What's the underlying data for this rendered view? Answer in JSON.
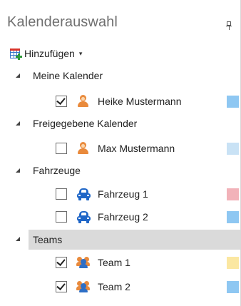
{
  "panel": {
    "title": "Kalenderauswahl",
    "add_label": "Hinzufügen",
    "add_caret": "▾"
  },
  "groups": [
    {
      "label": "Meine Kalender",
      "selected": false,
      "items": [
        {
          "label": "Heike Mustermann",
          "checked": true,
          "icon": "person-icon",
          "color": "#8ec7f2"
        }
      ]
    },
    {
      "label": "Freigegebene Kalender",
      "selected": false,
      "items": [
        {
          "label": "Max Mustermann",
          "checked": false,
          "icon": "person-icon",
          "color": "#c9e2f5"
        }
      ]
    },
    {
      "label": "Fahrzeuge",
      "selected": false,
      "items": [
        {
          "label": "Fahrzeug 1",
          "checked": false,
          "icon": "car-icon",
          "color": "#f2b2b9"
        },
        {
          "label": "Fahrzeug 2",
          "checked": false,
          "icon": "car-icon",
          "color": "#8ec7f2"
        }
      ]
    },
    {
      "label": "Teams",
      "selected": true,
      "items": [
        {
          "label": "Team 1",
          "checked": true,
          "icon": "team-icon",
          "color": "#fbe7a1"
        },
        {
          "label": "Team 2",
          "checked": true,
          "icon": "team-icon",
          "color": "#8ec7f2"
        }
      ]
    }
  ]
}
